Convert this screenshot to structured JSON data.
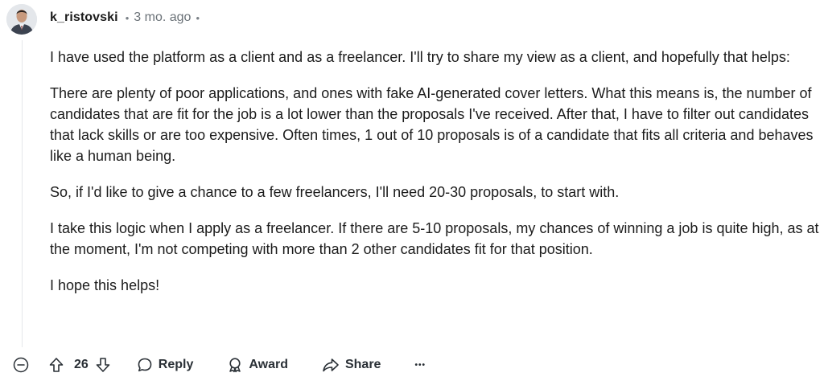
{
  "comment": {
    "author": "k_ristovski",
    "age": "3 mo. ago",
    "paragraphs": [
      "I have used the platform as a client and as a freelancer. I'll try to share my view as a client, and hopefully that helps:",
      "There are plenty of poor applications, and ones with fake AI-generated cover letters. What this means is, the number of candidates that are fit for the job is a lot lower than the proposals I've received. After that, I have to filter out candidates that lack skills or are too expensive. Often times, 1 out of 10 proposals is of a candidate that fits all criteria and behaves like a human being.",
      "So, if I'd like to give a chance to a few freelancers, I'll need 20-30 proposals, to start with.",
      "I take this logic when I apply as a freelancer. If there are 5-10 proposals, my chances of winning a job is quite high, as at the moment, I'm not competing with more than 2 other candidates fit for that position.",
      "I hope this helps!"
    ]
  },
  "actions": {
    "vote_count": "26",
    "reply_label": "Reply",
    "award_label": "Award",
    "share_label": "Share",
    "more_label": "•••"
  },
  "icons": {
    "collapse": "minus-circle-icon",
    "upvote": "arrow-up-icon",
    "downvote": "arrow-down-icon",
    "reply": "speech-bubble-icon",
    "award": "award-icon",
    "share": "share-arrow-icon",
    "more": "ellipsis-icon"
  }
}
